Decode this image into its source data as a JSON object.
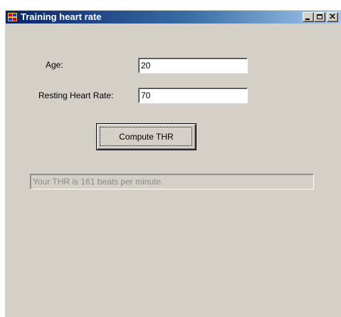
{
  "window": {
    "title": "Training heart rate"
  },
  "form": {
    "age_label": "Age:",
    "age_value": "20",
    "resting_label": "Resting Heart Rate:",
    "resting_value": "70",
    "compute_label": "Compute THR",
    "result_text": "Your THR is 161 beats per minute."
  },
  "icons": {
    "app": "app-icon",
    "minimize": "minimize-icon",
    "maximize": "maximize-icon",
    "close": "close-icon"
  },
  "colors": {
    "title_start": "#0a246a",
    "title_end": "#a6caf0",
    "face": "#d4d0c8",
    "result_text": "#8a8a8a"
  }
}
